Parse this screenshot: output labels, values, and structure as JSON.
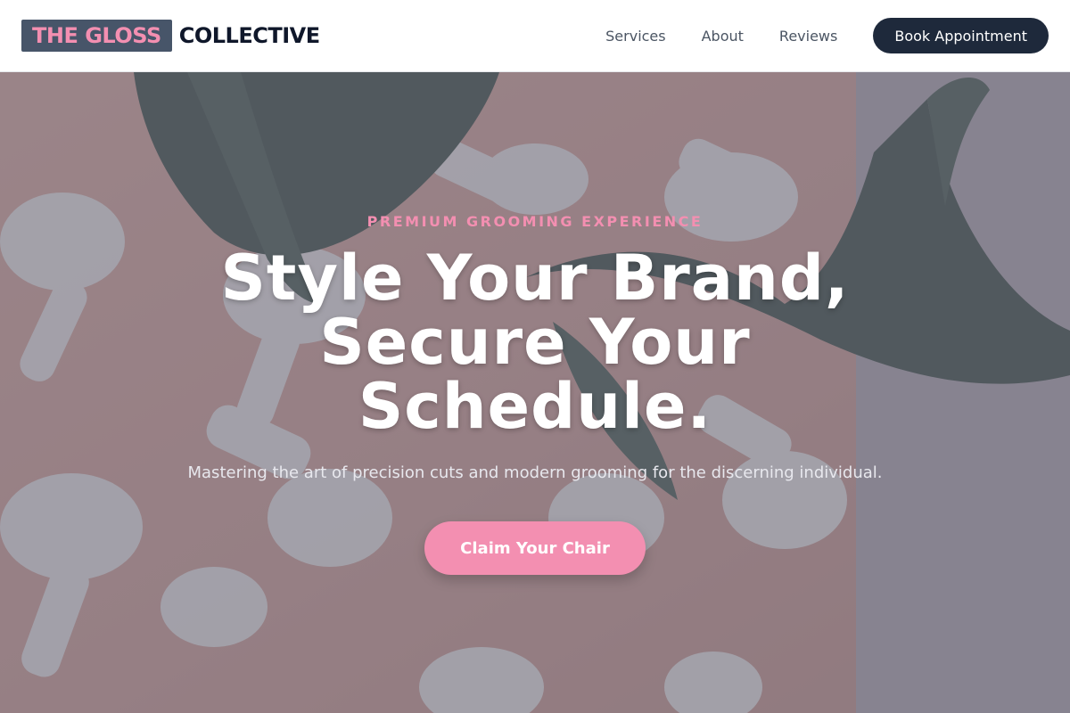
{
  "header": {
    "logo_highlight": "THE GLOSS",
    "logo_text": "COLLECTIVE",
    "nav": [
      {
        "label": "Services"
      },
      {
        "label": "About"
      },
      {
        "label": "Reviews"
      }
    ],
    "book_label": "Book Appointment"
  },
  "hero": {
    "eyebrow": "PREMIUM GROOMING EXPERIENCE",
    "headline_line1": "Style Your Brand,",
    "headline_line2": "Secure Your",
    "headline_line3": "Schedule.",
    "subhead": "Mastering the art of precision cuts and modern grooming for the discerning individual.",
    "cta_label": "Claim Your Chair",
    "image": "hair-dryers-and-palm-leaves-photo"
  },
  "colors": {
    "accent_pink": "#f38fb1",
    "navy": "#1e293b",
    "logo_box": "#475569"
  }
}
